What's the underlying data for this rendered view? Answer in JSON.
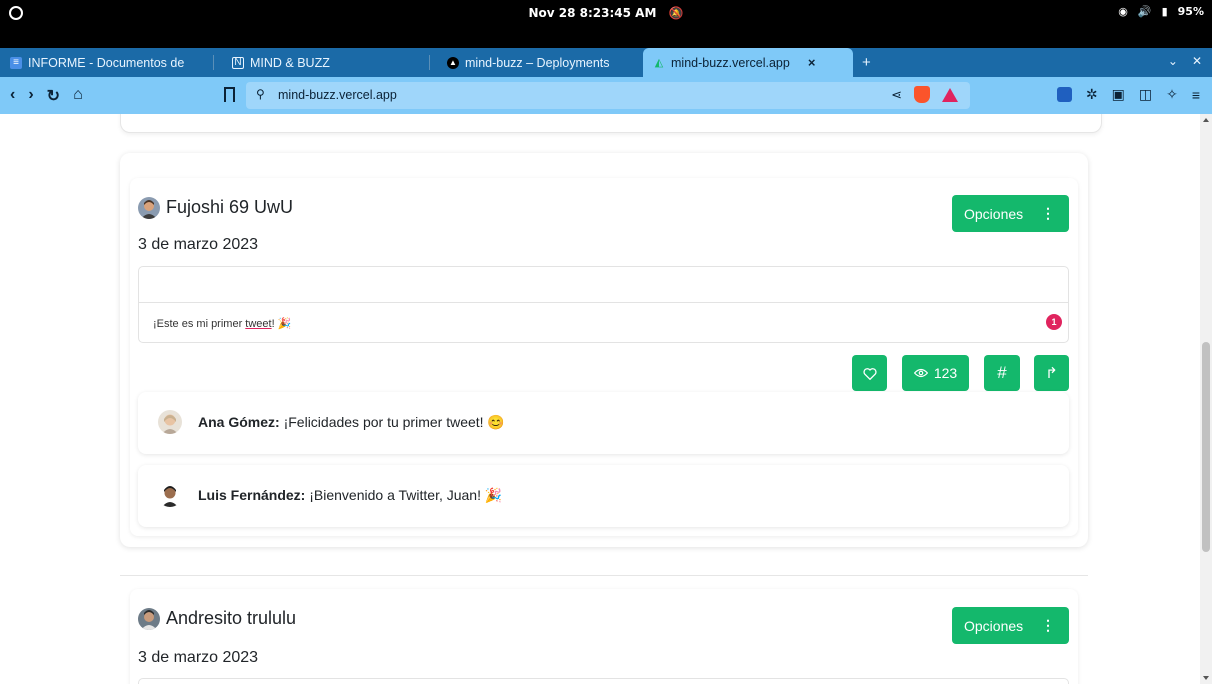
{
  "os": {
    "clock": "Nov 28  8:23:45 AM",
    "battery": "95%"
  },
  "tabs": [
    {
      "label": "INFORME - Documentos de",
      "icon": "docs-icon"
    },
    {
      "label": "MIND & BUZZ",
      "icon": "notion-icon"
    },
    {
      "label": "mind-buzz – Deployments",
      "icon": "vercel-icon"
    },
    {
      "label": "mind-buzz.vercel.app",
      "icon": "site-icon",
      "active": true
    }
  ],
  "toolbar": {
    "url": "mind-buzz.vercel.app"
  },
  "posts": [
    {
      "author": "Fujoshi 69 UwU",
      "date": "3 de marzo 2023",
      "options_label": "Opciones",
      "tweet_prefix": "¡Este es mi primer ",
      "tweet_link": "tweet",
      "tweet_suffix": "! 🎉",
      "notification_count": "1",
      "views": "123",
      "comments": [
        {
          "author": "Ana Gómez:",
          "text": " ¡Felicidades por tu primer tweet! 😊"
        },
        {
          "author": "Luis Fernández:",
          "text": " ¡Bienvenido a Twitter, Juan! 🎉"
        }
      ]
    },
    {
      "author": "Andresito trululu",
      "date": "3 de marzo 2023",
      "options_label": "Opciones"
    }
  ],
  "colors": {
    "accent": "#14b86c",
    "badge": "#e0245e",
    "browser_chrome": "#7fc9f8"
  }
}
